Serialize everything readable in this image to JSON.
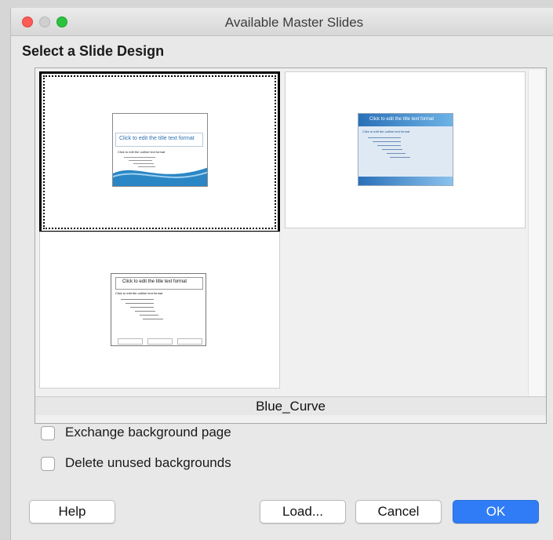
{
  "window": {
    "title": "Available Master Slides"
  },
  "section": {
    "label": "Select a Slide Design"
  },
  "designs": {
    "selected_name": "Blue_Curve",
    "thumbs": [
      {
        "title": "Click to edit the title text format",
        "outline": "Click to edit the outline text format"
      },
      {
        "title": "Click to edit the title text format",
        "outline": "Click to edit the outline text format"
      },
      {
        "title": "Click to edit the title text format",
        "outline": "Click to edit the outline text format"
      }
    ]
  },
  "options": {
    "exchange": {
      "label": "Exchange background page",
      "checked": false
    },
    "delete_unused": {
      "label": "Delete unused backgrounds",
      "checked": false
    }
  },
  "buttons": {
    "help": "Help",
    "load": "Load...",
    "cancel": "Cancel",
    "ok": "OK"
  },
  "colors": {
    "accent": "#2f7cf6",
    "selection_border": "#000000",
    "blue_curve": "#2b86c5"
  }
}
